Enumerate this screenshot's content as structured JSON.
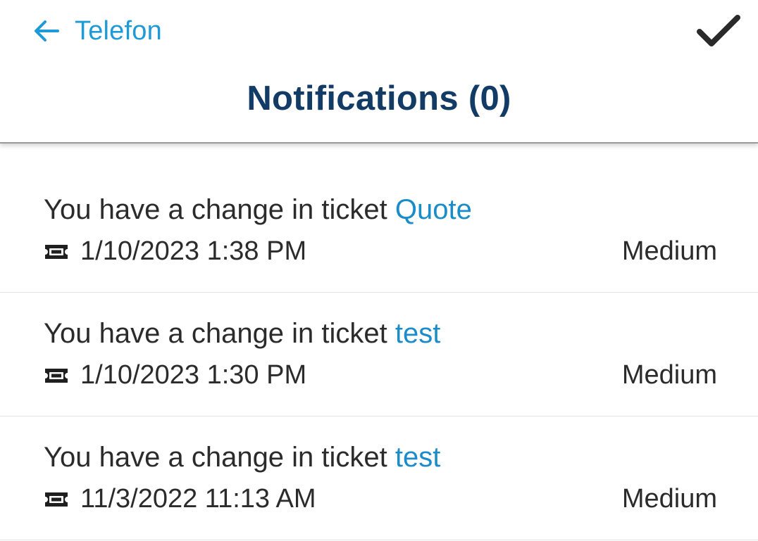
{
  "header": {
    "back_label": "Telefon",
    "title_text": "Notifications",
    "title_count": "(0)"
  },
  "notifications": [
    {
      "message_prefix": "You have a change in ticket",
      "ticket_name": "Quote",
      "datetime": "1/10/2023 1:38 PM",
      "priority": "Medium"
    },
    {
      "message_prefix": "You have a change in ticket",
      "ticket_name": "test",
      "datetime": "1/10/2023 1:30 PM",
      "priority": "Medium"
    },
    {
      "message_prefix": "You have a change in ticket",
      "ticket_name": "test",
      "datetime": "11/3/2022 11:13 AM",
      "priority": "Medium"
    }
  ],
  "icons": {
    "back": "arrow-left-icon",
    "confirm": "checkmark-icon",
    "ticket": "ticket-icon"
  },
  "colors": {
    "link": "#1a8cc7",
    "back": "#1e9ad6",
    "title": "#123c66",
    "text": "#2b2b2b"
  }
}
